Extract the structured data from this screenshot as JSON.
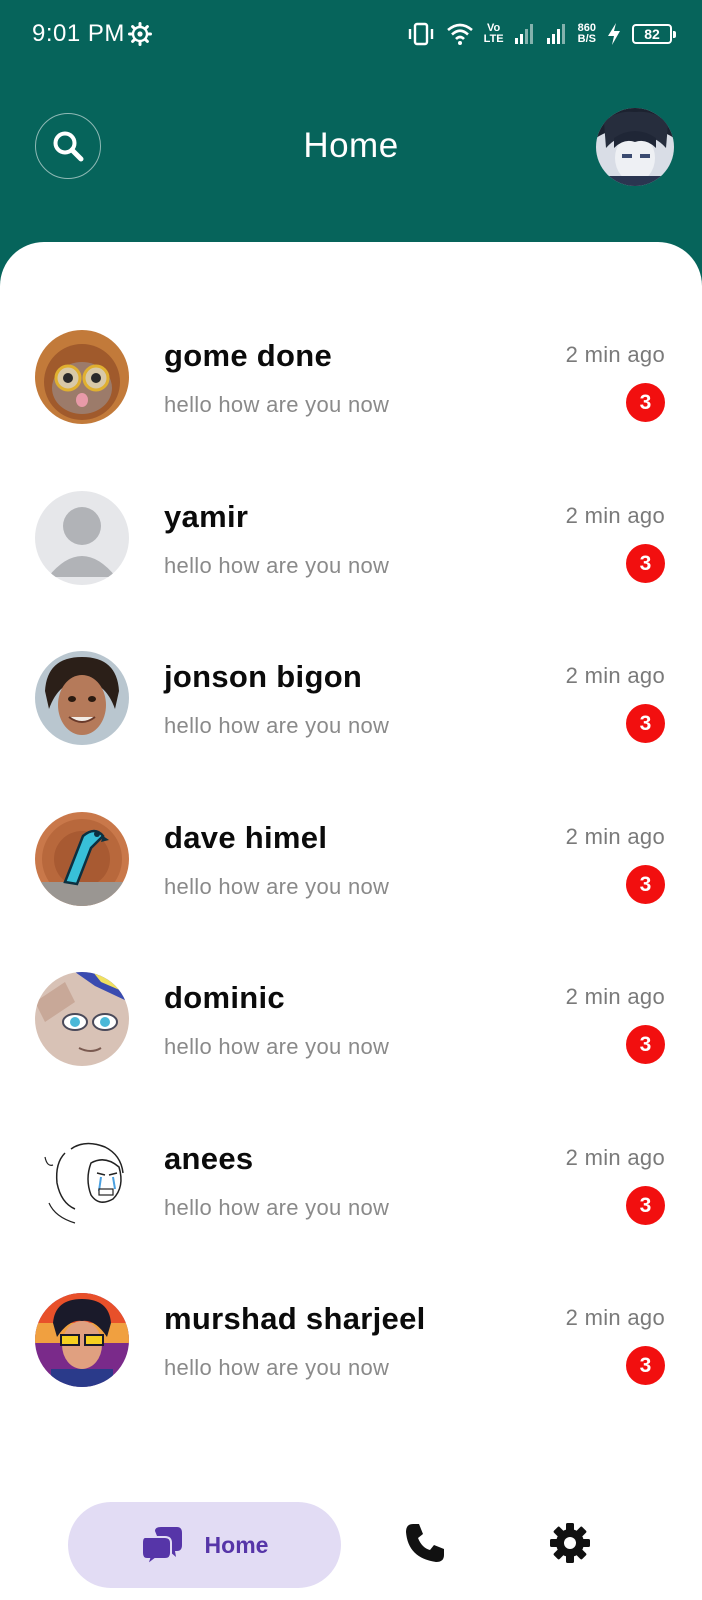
{
  "status_bar": {
    "time": "9:01 PM",
    "net_speed_value": "860",
    "net_speed_unit": "B/S",
    "volte": "Vo",
    "lte": "LTE",
    "battery": "82",
    "icons": [
      "settings-gear-icon",
      "vibrate-icon",
      "wifi-icon",
      "volte-icon",
      "signal-icon",
      "signal-icon",
      "charging-icon",
      "battery-icon"
    ]
  },
  "header": {
    "title": "Home",
    "search_icon": "search-icon",
    "background_color": "#06645b"
  },
  "chats": [
    {
      "name": "gome done",
      "message": "hello how are you now",
      "time": "2 min ago",
      "unread": "3"
    },
    {
      "name": "yamir",
      "message": "hello how are you now",
      "time": "2 min ago",
      "unread": "3"
    },
    {
      "name": "jonson bigon",
      "message": "hello how are you now",
      "time": "2 min ago",
      "unread": "3"
    },
    {
      "name": "dave himel",
      "message": "hello how are you now",
      "time": "2 min ago",
      "unread": "3"
    },
    {
      "name": "dominic",
      "message": "hello how are you now",
      "time": "2 min ago",
      "unread": "3"
    },
    {
      "name": "anees",
      "message": "hello how are you now",
      "time": "2 min ago",
      "unread": "3"
    },
    {
      "name": "murshad sharjeel",
      "message": "hello how are you now",
      "time": "2 min ago",
      "unread": "3"
    }
  ],
  "bottom_nav": {
    "home_label": "Home",
    "home_icon": "chat-bubbles-icon",
    "call_icon": "phone-icon",
    "settings_icon": "gear-icon",
    "active_color": "#5635a8",
    "active_bg": "#e2dcf4"
  },
  "colors": {
    "badge": "#f20f0f",
    "name_text": "#0b0b0b",
    "message_text": "#8a8a8a"
  }
}
